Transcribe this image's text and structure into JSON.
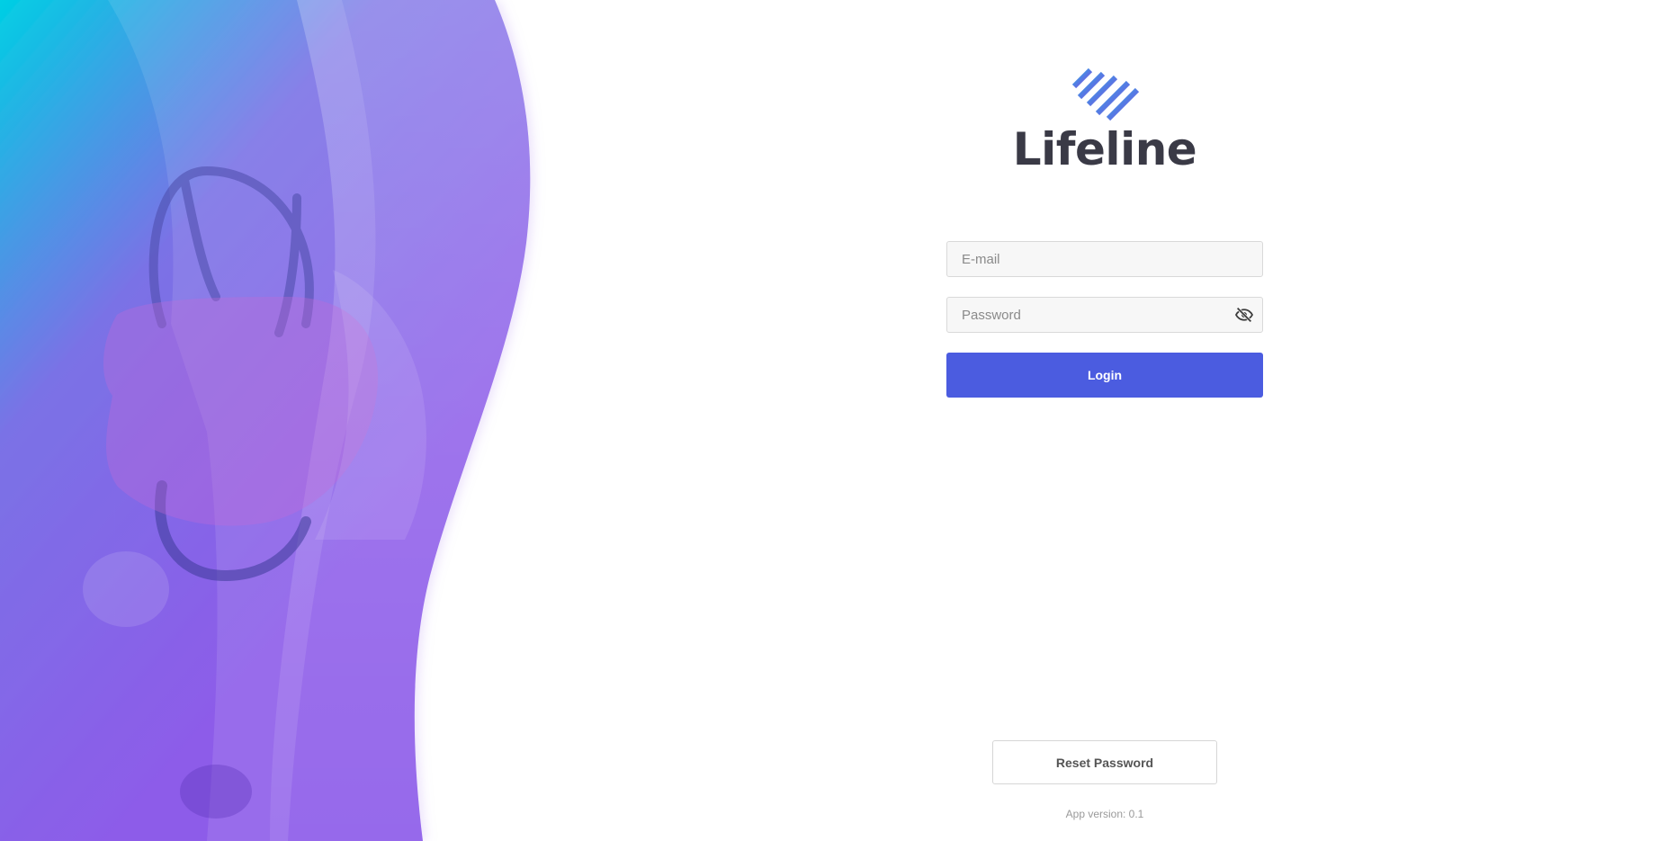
{
  "brand": {
    "name": "Lifeline",
    "logo_icon": "heart-stripes-logo-icon"
  },
  "login_form": {
    "email_placeholder": "E-mail",
    "password_placeholder": "Password",
    "password_toggle_icon": "eye-off-icon",
    "login_label": "Login"
  },
  "footer": {
    "reset_label": "Reset Password",
    "version_text": "App version: 0.1"
  },
  "colors": {
    "accent": "#4b5ce0",
    "hero_gradient_start": "#00cfe4",
    "hero_gradient_end": "#8d5ce9",
    "brand_text": "#3a3a46"
  }
}
